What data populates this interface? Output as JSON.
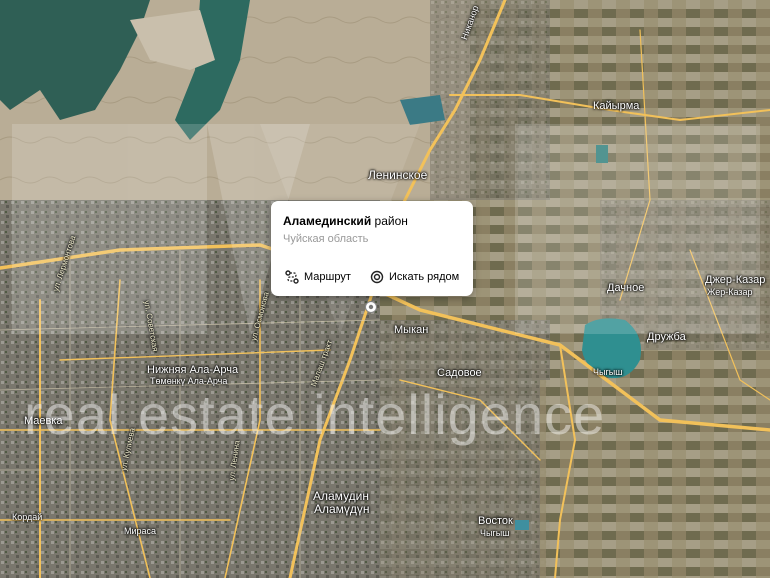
{
  "popup": {
    "title_bold": "Аламединский",
    "title_rest": " район",
    "subtitle": "Чуйская область",
    "route_label": "Маршрут",
    "search_label": "Искать рядом"
  },
  "watermark": "real estate intelligence",
  "places": {
    "leninskoe": "Ленинское",
    "kaiyrma": "Кайырма",
    "dachnoe": "Дачное",
    "jer_kazar_ru": "Джер-Казар",
    "jer_kazar_ky": "Жер-Казар",
    "druzhba": "Дружба",
    "mykan": "Мыкан",
    "sadovoe": "Садовое",
    "nizhnyaya_ala_archa": "Нижняя Ала-Арча",
    "tomenku_ala_archa": "Төмөнкү Ала-Арча",
    "maevka": "Маевка",
    "alamudun_ru": "Аламудин",
    "alamudun_ky": "Аламүдүн",
    "vostok": "Восток",
    "chygysh": "Чыгыш",
    "chygysh2": "Чыгыш",
    "mirasa": "Мираса",
    "kurdai": "Кордай",
    "nikanor": "Никанор"
  },
  "roads": {
    "r1": "ул. Лермонтова",
    "r2": "ул. Советская",
    "r3": "ул. Кулиева",
    "r4": "ул. Ленина",
    "r5": "ул. Осмонова",
    "r6": "Малаш тракт"
  },
  "colors": {
    "accent": "#ffcc33",
    "road": "#f2c15a",
    "water": "#2f6d6a"
  },
  "icons": {
    "route": "route-icon",
    "search": "search-nearby-icon",
    "marker": "location-marker-icon"
  }
}
